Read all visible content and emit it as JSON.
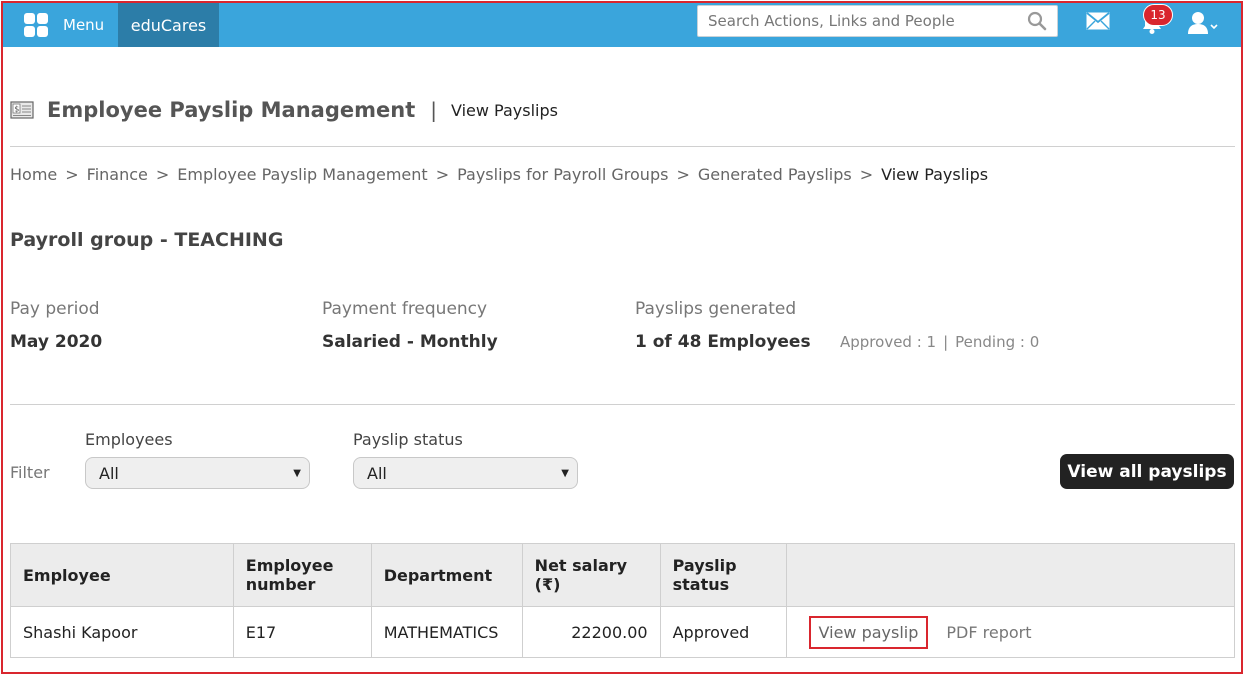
{
  "topbar": {
    "menu_label": "Menu",
    "app_name": "eduCares",
    "search_placeholder": "Search Actions, Links and People",
    "notification_count": "13"
  },
  "header": {
    "title": "Employee Payslip Management",
    "separator": "|",
    "subtitle": "View Payslips"
  },
  "breadcrumb": {
    "items": [
      "Home",
      "Finance",
      "Employee Payslip Management",
      "Payslips for Payroll Groups",
      "Generated Payslips"
    ],
    "current": "View Payslips",
    "separator": ">"
  },
  "payroll_group_title": "Payroll group - TEACHING",
  "summary": {
    "pay_period_label": "Pay period",
    "pay_period_value": "May 2020",
    "frequency_label": "Payment frequency",
    "frequency_value": "Salaried - Monthly",
    "generated_label": "Payslips generated",
    "generated_value": "1 of 48 Employees",
    "approved_text": "Approved : 1",
    "approval_separator": "|",
    "pending_text": "Pending : 0"
  },
  "filter": {
    "label": "Filter",
    "employees_label": "Employees",
    "employees_value": "All",
    "status_label": "Payslip status",
    "status_value": "All",
    "view_all_label": "View all payslips"
  },
  "table": {
    "headers": {
      "employee": "Employee",
      "employee_number": "Employee number",
      "department": "Department",
      "net_salary": "Net salary (₹)",
      "payslip_status": "Payslip status",
      "actions": ""
    },
    "rows": [
      {
        "employee": "Shashi Kapoor",
        "employee_number": "E17",
        "department": "MATHEMATICS",
        "net_salary": "22200.00",
        "payslip_status": "Approved",
        "view_label": "View payslip",
        "pdf_label": "PDF report"
      }
    ]
  },
  "colors": {
    "topbar": "#3aa5dc",
    "app_tab": "#2c7da8",
    "highlight": "#d9262e",
    "badge": "#d9262e"
  },
  "icons": [
    "menu-grid-icon",
    "search-icon",
    "mail-icon",
    "bell-icon",
    "user-icon",
    "payslip-icon",
    "chevron-down-icon"
  ]
}
